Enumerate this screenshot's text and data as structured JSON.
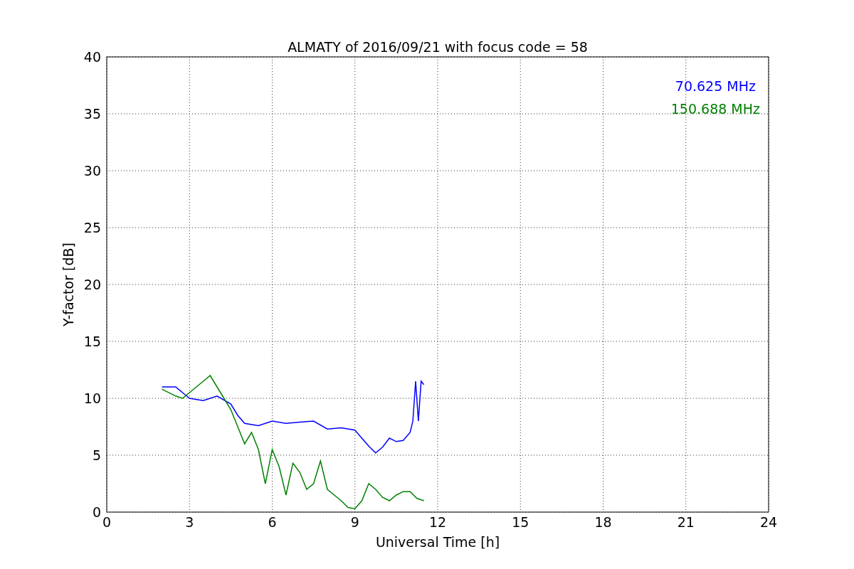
{
  "chart_data": {
    "type": "line",
    "title": "ALMATY of 2016/09/21 with focus code = 58",
    "xlabel": "Universal Time [h]",
    "ylabel": "Y-factor [dB]",
    "grid": true,
    "xlim": [
      0,
      24
    ],
    "ylim": [
      0,
      40
    ],
    "xticks": [
      0,
      3,
      6,
      9,
      12,
      15,
      18,
      21,
      24
    ],
    "yticks": [
      0,
      5,
      10,
      15,
      20,
      25,
      30,
      35,
      40
    ],
    "series": [
      {
        "name": "70.625 MHz",
        "color": "#0000ff",
        "x": [
          2,
          2.5,
          3,
          3.5,
          4,
          4.5,
          4.75,
          5,
          5.5,
          6,
          6.5,
          7,
          7.5,
          8,
          8.5,
          9,
          9.5,
          9.75,
          10,
          10.25,
          10.5,
          10.75,
          11,
          11.1,
          11.2,
          11.3,
          11.4,
          11.5
        ],
        "values": [
          11,
          11,
          10,
          9.8,
          10.2,
          9.5,
          8.5,
          7.8,
          7.6,
          8,
          7.8,
          7.9,
          8,
          7.3,
          7.4,
          7.2,
          5.8,
          5.2,
          5.7,
          6.5,
          6.2,
          6.3,
          7,
          8,
          11.5,
          8,
          11.5,
          11.2
        ]
      },
      {
        "name": "150.688 MHz",
        "color": "#008000",
        "x": [
          2,
          2.5,
          2.75,
          3,
          3.25,
          3.5,
          3.75,
          4,
          4.25,
          4.5,
          4.75,
          5,
          5.25,
          5.5,
          5.75,
          6,
          6.25,
          6.5,
          6.75,
          7,
          7.25,
          7.5,
          7.75,
          8,
          8.25,
          8.5,
          8.75,
          9,
          9.25,
          9.5,
          9.75,
          10,
          10.25,
          10.5,
          10.75,
          11,
          11.25,
          11.5
        ],
        "values": [
          10.8,
          10.2,
          10,
          10.5,
          11,
          11.5,
          12,
          11,
          10,
          9,
          7.5,
          6,
          7,
          5.5,
          2.5,
          5.5,
          4,
          1.5,
          4.3,
          3.5,
          2,
          2.5,
          4.5,
          2,
          1.5,
          1,
          0.4,
          0.3,
          1,
          2.5,
          2,
          1.3,
          1,
          1.5,
          1.8,
          1.8,
          1.2,
          1
        ]
      }
    ]
  }
}
